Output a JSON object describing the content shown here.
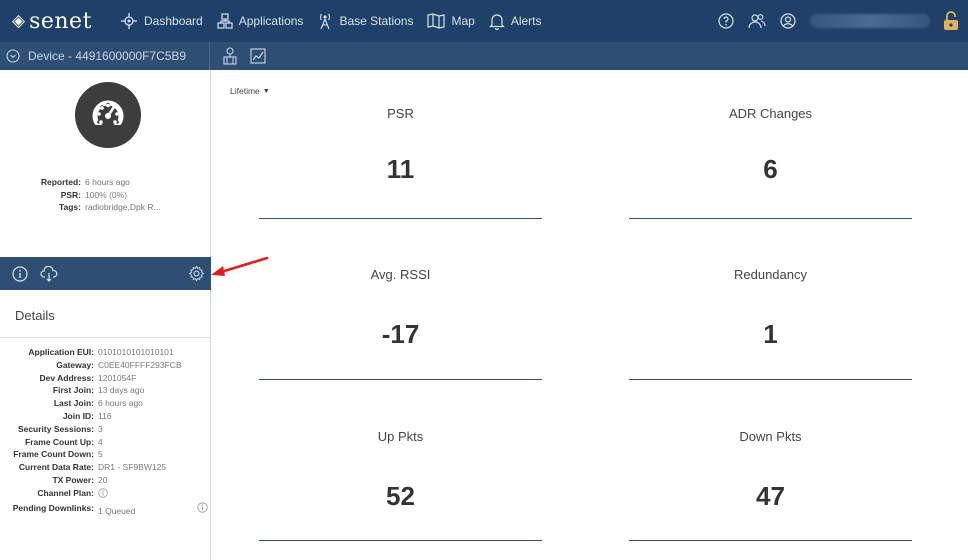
{
  "topnav": {
    "brand": "senet",
    "items": [
      {
        "label": "Dashboard",
        "icon": "dashboard-icon"
      },
      {
        "label": "Applications",
        "icon": "applications-icon"
      },
      {
        "label": "Base Stations",
        "icon": "base-station-icon"
      },
      {
        "label": "Map",
        "icon": "map-icon"
      },
      {
        "label": "Alerts",
        "icon": "bell-icon"
      }
    ],
    "right_icons": [
      "help-icon",
      "users-icon",
      "account-icon",
      "lock-icon"
    ]
  },
  "device": {
    "title": "Device - 4491600000F7C5B9",
    "summary": [
      {
        "key": "Reported:",
        "value": "6 hours ago"
      },
      {
        "key": "PSR:",
        "value": "100% (0%)"
      },
      {
        "key": "Tags:",
        "value": "radiobridge,Dpk R..."
      }
    ]
  },
  "details": {
    "heading": "Details",
    "rows": [
      {
        "key": "Application EUI:",
        "value": "0101010101010101"
      },
      {
        "key": "Gateway:",
        "value": "C0EE40FFFF293FCB"
      },
      {
        "key": "Dev Address:",
        "value": "1201054F"
      },
      {
        "key": "First Join:",
        "value": "13 days ago"
      },
      {
        "key": "Last Join:",
        "value": "6 hours ago"
      },
      {
        "key": "Join ID:",
        "value": "116"
      },
      {
        "key": "Security Sessions:",
        "value": "3"
      },
      {
        "key": "Frame Count Up:",
        "value": "4"
      },
      {
        "key": "Frame Count Down:",
        "value": "5"
      },
      {
        "key": "Current Data Rate:",
        "value": "DR1 - SF9BW125"
      },
      {
        "key": "TX Power:",
        "value": "20"
      },
      {
        "key": "Channel Plan:",
        "value": ""
      },
      {
        "key": "Pending Downlinks:",
        "value": "1 Queued"
      }
    ]
  },
  "main": {
    "period": "Lifetime",
    "stats": [
      {
        "label": "PSR",
        "value": "11"
      },
      {
        "label": "ADR Changes",
        "value": "6"
      },
      {
        "label": "Avg. RSSI",
        "value": "-17"
      },
      {
        "label": "Redundancy",
        "value": "1"
      },
      {
        "label": "Up Pkts",
        "value": "52"
      },
      {
        "label": "Down Pkts",
        "value": "47"
      }
    ]
  },
  "colors": {
    "nav": "#1f4068",
    "subbar": "#2e4f73",
    "accent_arrow": "#e02020"
  }
}
